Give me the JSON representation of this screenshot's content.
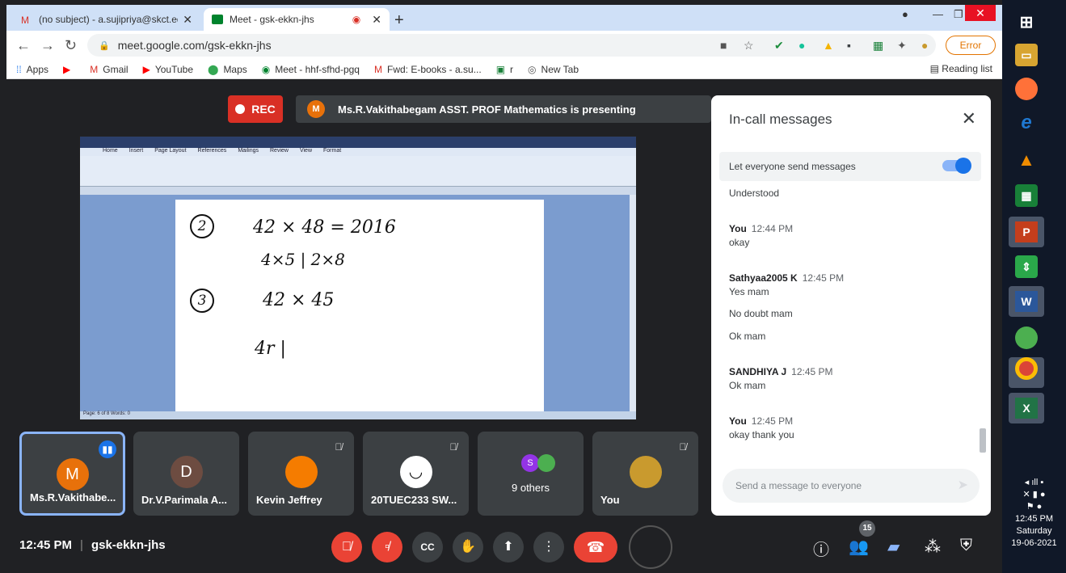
{
  "browser": {
    "tabs": [
      {
        "title": "(no subject) - a.sujipriya@skct.ed",
        "active": false
      },
      {
        "title": "Meet - gsk-ekkn-jhs",
        "active": true
      }
    ],
    "url": "meet.google.com/gsk-ekkn-jhs",
    "error_label": "Error",
    "bookmarks": [
      "Apps",
      "Gmail",
      "YouTube",
      "Maps",
      "Meet - hhf-sfhd-pgq",
      "Fwd: E-books - a.su...",
      "r",
      "New Tab"
    ],
    "reading_list": "Reading list"
  },
  "meet": {
    "rec_label": "REC",
    "presenter_initial": "M",
    "presenting_text": "Ms.R.Vakithabegam ASST. PROF Mathematics is presenting",
    "handwriting": {
      "line1_num": "2",
      "line1": "42 × 48 = 2016",
      "line2": "4×5 | 2×8",
      "line3_num": "3",
      "line3": "42 × 45",
      "line4": "4r  |"
    },
    "word_status": "Page: 6 of 8   Words: 0",
    "word_tabs": [
      "Home",
      "Insert",
      "Page Layout",
      "References",
      "Mailings",
      "Review",
      "View",
      "Format"
    ],
    "participants": [
      {
        "initial": "M",
        "name": "Ms.R.Vakithabe...",
        "color": "#e8710a"
      },
      {
        "initial": "D",
        "name": "Dr.V.Parimala A...",
        "color": "#6d4c41"
      },
      {
        "initial": "",
        "name": "Kevin Jeffrey",
        "color": "#f57c00"
      },
      {
        "initial": "",
        "name": "20TUEC233 SW...",
        "color": "#ffffff"
      },
      {
        "initial": "S",
        "name": "",
        "center": "9 others",
        "color": "#9334e6"
      },
      {
        "initial": "",
        "name": "You",
        "color": "#c99a2e"
      }
    ],
    "clock": "12:45 PM",
    "meeting_code": "gsk-ekkn-jhs",
    "participant_count": "15"
  },
  "chat": {
    "title": "In-call messages",
    "toggle_label": "Let everyone send messages",
    "messages": [
      {
        "sender": "",
        "time": "",
        "text": "Understood"
      },
      {
        "sender": "You",
        "time": "12:44 PM",
        "text": "okay"
      },
      {
        "sender": "Sathyaa2005 K",
        "time": "12:45 PM",
        "text": "Yes mam"
      },
      {
        "sender": "",
        "time": "",
        "text": "No doubt mam"
      },
      {
        "sender": "",
        "time": "",
        "text": "Ok mam"
      },
      {
        "sender": "SANDHIYA J",
        "time": "12:45 PM",
        "text": "Ok mam"
      },
      {
        "sender": "You",
        "time": "12:45 PM",
        "text": "okay thank you"
      }
    ],
    "input_placeholder": "Send a message to everyone"
  },
  "taskbar": {
    "time": "12:45 PM",
    "day": "Saturday",
    "date": "19-06-2021"
  }
}
